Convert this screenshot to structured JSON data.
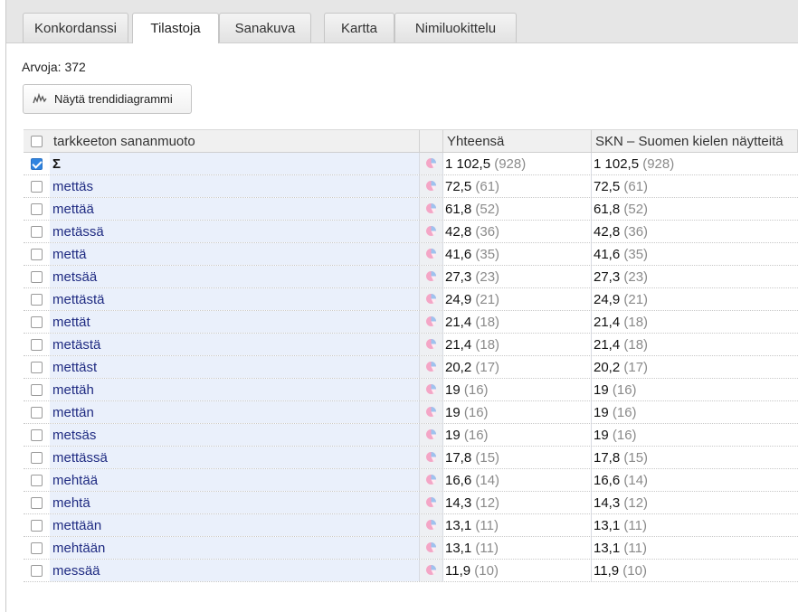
{
  "tabs": [
    {
      "label": "Konkordanssi",
      "active": false
    },
    {
      "label": "Tilastoja",
      "active": true
    },
    {
      "label": "Sanakuva",
      "active": false
    },
    {
      "label": "Kartta",
      "active": false
    },
    {
      "label": "Nimiluokittelu",
      "active": false
    }
  ],
  "summary": {
    "values_text": "Arvoja: 372"
  },
  "trend_button": {
    "label": "Näytä trendidiagrammi",
    "icon": "trend-chart-icon"
  },
  "table": {
    "headers": {
      "word": "tarkkeeton sananmuoto",
      "total": "Yhteensä",
      "corpus": "SKN – Suomen kielen näytteitä"
    },
    "rows": [
      {
        "word": "Σ",
        "checked": true,
        "total_rel": "1 102,5",
        "total_abs": "(928)",
        "corpus_rel": "1 102,5",
        "corpus_abs": "(928)"
      },
      {
        "word": "mettäs",
        "checked": false,
        "total_rel": "72,5",
        "total_abs": "(61)",
        "corpus_rel": "72,5",
        "corpus_abs": "(61)"
      },
      {
        "word": "mettää",
        "checked": false,
        "total_rel": "61,8",
        "total_abs": "(52)",
        "corpus_rel": "61,8",
        "corpus_abs": "(52)"
      },
      {
        "word": "metässä",
        "checked": false,
        "total_rel": "42,8",
        "total_abs": "(36)",
        "corpus_rel": "42,8",
        "corpus_abs": "(36)"
      },
      {
        "word": "mettä",
        "checked": false,
        "total_rel": "41,6",
        "total_abs": "(35)",
        "corpus_rel": "41,6",
        "corpus_abs": "(35)"
      },
      {
        "word": "metsää",
        "checked": false,
        "total_rel": "27,3",
        "total_abs": "(23)",
        "corpus_rel": "27,3",
        "corpus_abs": "(23)"
      },
      {
        "word": "mettästä",
        "checked": false,
        "total_rel": "24,9",
        "total_abs": "(21)",
        "corpus_rel": "24,9",
        "corpus_abs": "(21)"
      },
      {
        "word": "mettät",
        "checked": false,
        "total_rel": "21,4",
        "total_abs": "(18)",
        "corpus_rel": "21,4",
        "corpus_abs": "(18)"
      },
      {
        "word": "metästä",
        "checked": false,
        "total_rel": "21,4",
        "total_abs": "(18)",
        "corpus_rel": "21,4",
        "corpus_abs": "(18)"
      },
      {
        "word": "mettäst",
        "checked": false,
        "total_rel": "20,2",
        "total_abs": "(17)",
        "corpus_rel": "20,2",
        "corpus_abs": "(17)"
      },
      {
        "word": "mettäh",
        "checked": false,
        "total_rel": "19",
        "total_abs": "(16)",
        "corpus_rel": "19",
        "corpus_abs": "(16)"
      },
      {
        "word": "mettän",
        "checked": false,
        "total_rel": "19",
        "total_abs": "(16)",
        "corpus_rel": "19",
        "corpus_abs": "(16)"
      },
      {
        "word": "metsäs",
        "checked": false,
        "total_rel": "19",
        "total_abs": "(16)",
        "corpus_rel": "19",
        "corpus_abs": "(16)"
      },
      {
        "word": "mettässä",
        "checked": false,
        "total_rel": "17,8",
        "total_abs": "(15)",
        "corpus_rel": "17,8",
        "corpus_abs": "(15)"
      },
      {
        "word": "mehtää",
        "checked": false,
        "total_rel": "16,6",
        "total_abs": "(14)",
        "corpus_rel": "16,6",
        "corpus_abs": "(14)"
      },
      {
        "word": "mehtä",
        "checked": false,
        "total_rel": "14,3",
        "total_abs": "(12)",
        "corpus_rel": "14,3",
        "corpus_abs": "(12)"
      },
      {
        "word": "mettään",
        "checked": false,
        "total_rel": "13,1",
        "total_abs": "(11)",
        "corpus_rel": "13,1",
        "corpus_abs": "(11)"
      },
      {
        "word": "mehtään",
        "checked": false,
        "total_rel": "13,1",
        "total_abs": "(11)",
        "corpus_rel": "13,1",
        "corpus_abs": "(11)"
      },
      {
        "word": "messää",
        "checked": false,
        "total_rel": "11,9",
        "total_abs": "(10)",
        "corpus_rel": "11,9",
        "corpus_abs": "(10)"
      }
    ]
  },
  "colors": {
    "link_text": "#1f2b82",
    "checkbox_checked": "#2f84e0",
    "word_column_bg": "#eaf0fb",
    "count_text": "#8a8a8a",
    "pie_slice_a": "#f4a6c6",
    "pie_slice_b": "#9ec3ef"
  },
  "icons": {
    "pie": "pie-chart-icon",
    "checkbox": "checkbox"
  }
}
